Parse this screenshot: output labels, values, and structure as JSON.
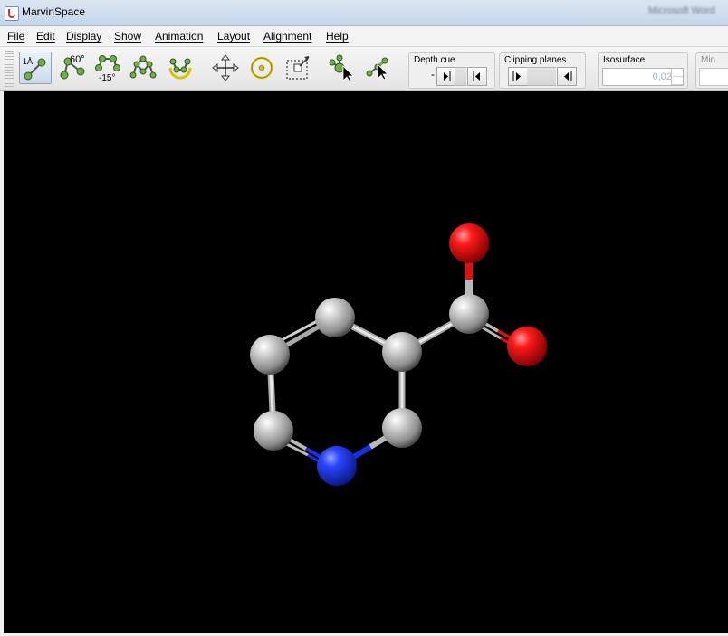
{
  "window": {
    "title": "MarvinSpace",
    "background_title": "Microsoft Word"
  },
  "menu": [
    "File",
    "Edit",
    "Display",
    "Show",
    "Animation",
    "Layout",
    "Alignment",
    "Help"
  ],
  "toolbar": {
    "measure_distance_label": "1Å",
    "measure_angle_label": "60°",
    "measure_dihedral_label": "-15°",
    "depth_cue": {
      "label": "Depth cue",
      "minus": "-"
    },
    "clipping_planes": {
      "label": "Clipping planes"
    },
    "isosurface": {
      "label": "Isosurface",
      "value": "0,02"
    },
    "min": {
      "label": "Min"
    }
  },
  "molecule": {
    "atoms": [
      "C",
      "C",
      "C",
      "C",
      "C",
      "N",
      "C",
      "O",
      "O"
    ],
    "colors": {
      "C": "#c0c0c0",
      "N": "#1530e0",
      "O": "#e01010"
    }
  }
}
